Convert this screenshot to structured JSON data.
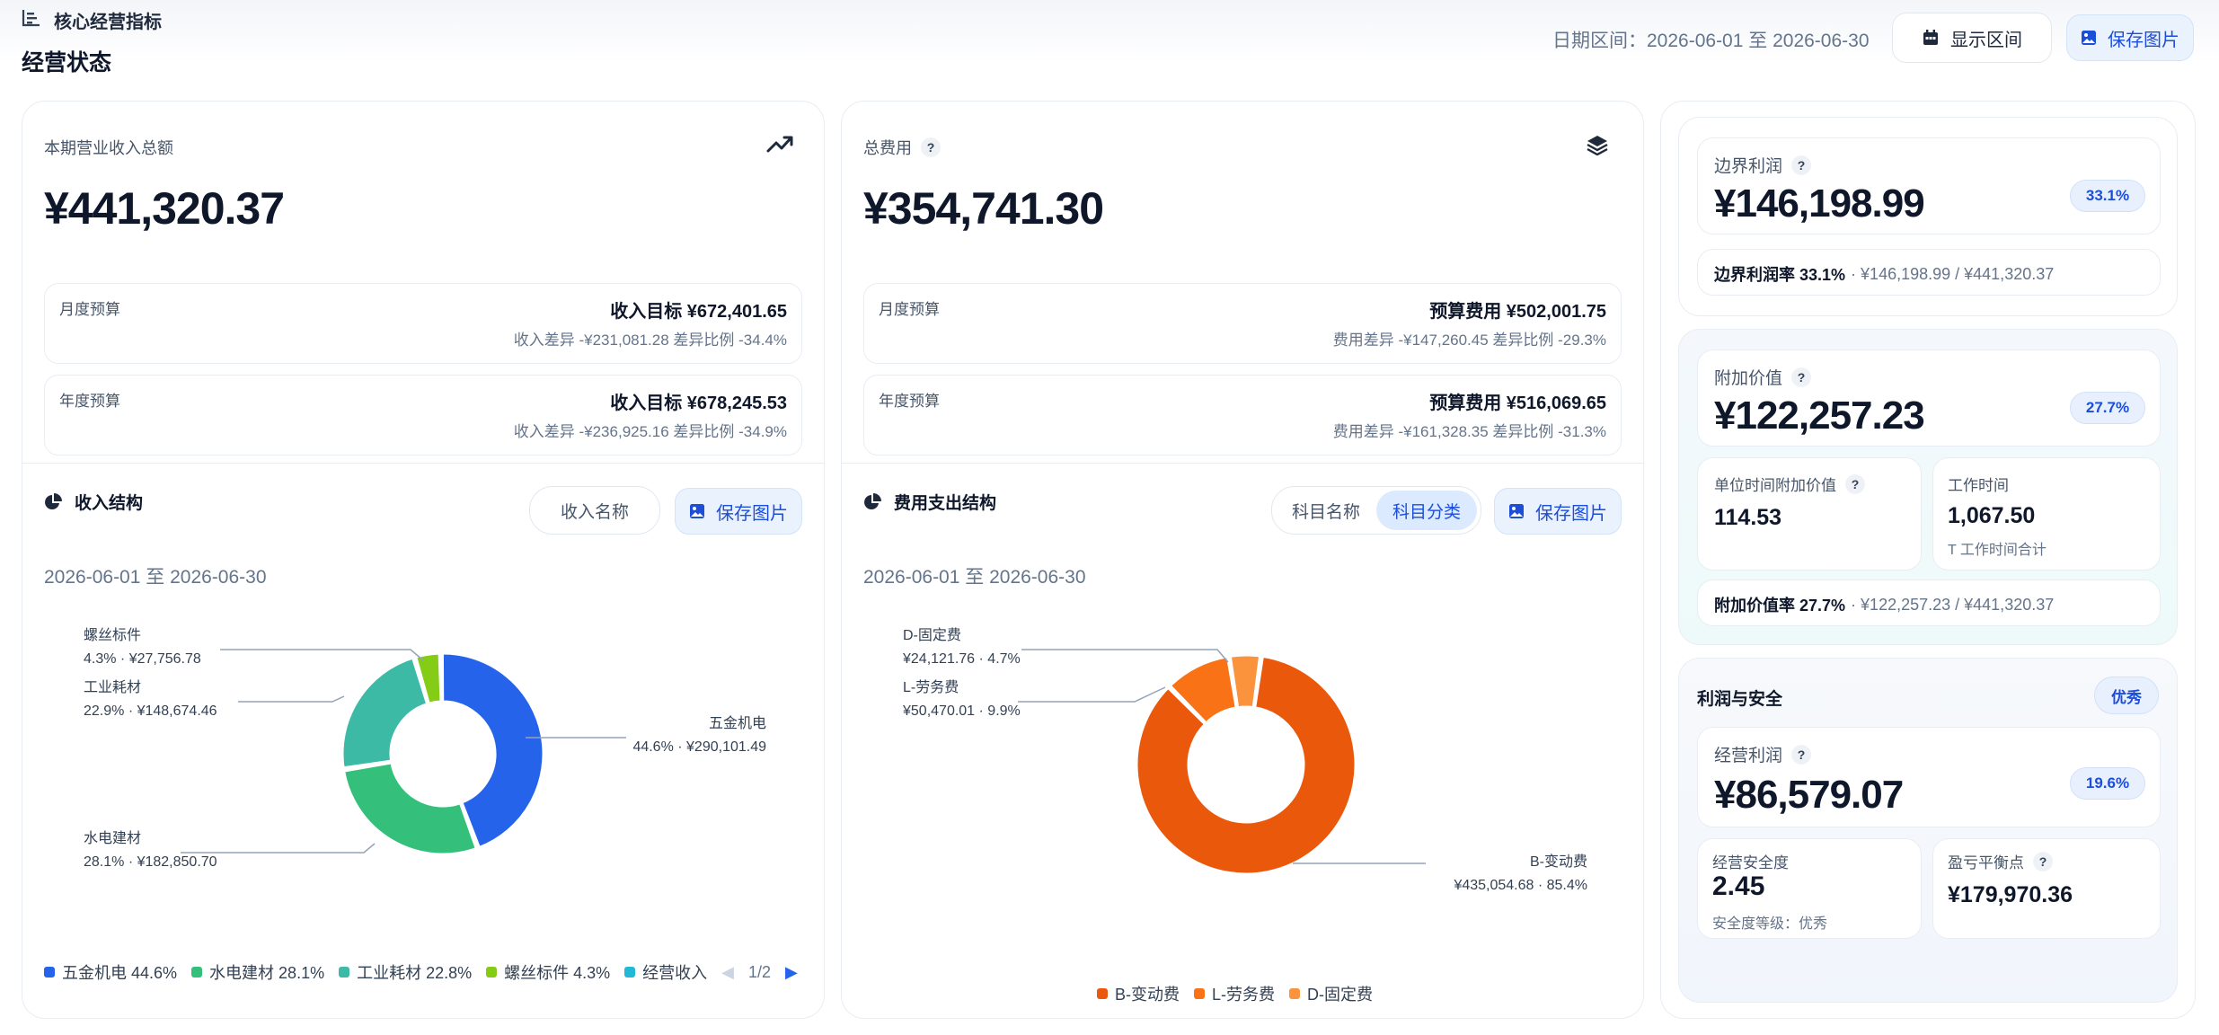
{
  "header": {
    "section_label": "核心经营指标",
    "page_title": "经营状态",
    "date_range_text": "日期区间：2026-06-01 至 2026-06-30",
    "show_range_button": "显示区间",
    "save_image_button": "保存图片"
  },
  "revenue": {
    "label": "本期营业收入总额",
    "value": "¥441,320.37",
    "monthly": {
      "label": "月度预算",
      "target": "收入目标 ¥672,401.65",
      "detail": "收入差异 -¥231,081.28  差异比例 -34.4%"
    },
    "yearly": {
      "label": "年度预算",
      "target": "收入目标 ¥678,245.53",
      "detail": "收入差异 -¥236,925.16  差异比例 -34.9%"
    },
    "structure": {
      "title": "收入结构",
      "toggle_label": "收入名称",
      "save_label": "保存图片",
      "date": "2026-06-01 至 2026-06-30",
      "callouts": [
        {
          "name": "螺丝标件",
          "detail": "4.3% · ¥27,756.78"
        },
        {
          "name": "工业耗材",
          "detail": "22.9% · ¥148,674.46"
        },
        {
          "name": "水电建材",
          "detail": "28.1% · ¥182,850.70"
        },
        {
          "name": "五金机电",
          "detail": "44.6% · ¥290,101.49"
        }
      ],
      "legend": [
        "五金机电 44.6%",
        "水电建材 28.1%",
        "工业耗材 22.8%",
        "螺丝标件 4.3%",
        "经营收入"
      ],
      "legend_page": "1/2"
    }
  },
  "expense": {
    "label": "总费用",
    "value": "¥354,741.30",
    "monthly": {
      "label": "月度预算",
      "target": "预算费用 ¥502,001.75",
      "detail": "费用差异 -¥147,260.45  差异比例 -29.3%"
    },
    "yearly": {
      "label": "年度预算",
      "target": "预算费用 ¥516,069.65",
      "detail": "费用差异 -¥161,328.35  差异比例 -31.3%"
    },
    "structure": {
      "title": "费用支出结构",
      "toggle_a": "科目名称",
      "toggle_b": "科目分类",
      "save_label": "保存图片",
      "date": "2026-06-01 至 2026-06-30",
      "callouts": [
        {
          "name": "D-固定费",
          "detail": "¥24,121.76 · 4.7%"
        },
        {
          "name": "L-劳务费",
          "detail": "¥50,470.01 · 9.9%"
        },
        {
          "name": "B-变动费",
          "detail": "¥435,054.68 · 85.4%"
        }
      ],
      "legend": [
        "B-变动费",
        "L-劳务费",
        "D-固定费"
      ]
    }
  },
  "marginal": {
    "label": "边界利润",
    "value": "¥146,198.99",
    "pill": "33.1%",
    "rate_label": "边界利润率 33.1%",
    "rate_detail": "· ¥146,198.99 / ¥441,320.37"
  },
  "added_value": {
    "label": "附加价值",
    "value": "¥122,257.23",
    "pill": "27.7%",
    "per_hour_label": "单位时间附加价值",
    "per_hour_value": "114.53",
    "work_time_label": "工作时间",
    "work_time_value": "1,067.50",
    "work_time_note": "T 工作时间合计",
    "rate_label": "附加价值率 27.7%",
    "rate_detail": "· ¥122,257.23 / ¥441,320.37"
  },
  "profit_safety": {
    "title": "利润与安全",
    "badge": "优秀",
    "op_profit_label": "经营利润",
    "op_profit_value": "¥86,579.07",
    "op_profit_pill": "19.6%",
    "safety_label": "经营安全度",
    "safety_value": "2.45",
    "safety_note": "安全度等级：优秀",
    "breakeven_label": "盈亏平衡点",
    "breakeven_value": "¥179,970.36"
  },
  "chart_data": [
    {
      "type": "pie",
      "title": "收入结构",
      "categories": [
        "五金机电",
        "水电建材",
        "工业耗材",
        "螺丝标件"
      ],
      "values": [
        290101.49,
        182850.7,
        148674.46,
        27756.78
      ],
      "percent": [
        44.6,
        28.1,
        22.9,
        4.3
      ],
      "colors": [
        "#2563eb",
        "#34c07a",
        "#3dbaa6",
        "#84cc16"
      ]
    },
    {
      "type": "pie",
      "title": "费用支出结构",
      "categories": [
        "B-变动费",
        "L-劳务费",
        "D-固定费"
      ],
      "values": [
        435054.68,
        50470.01,
        24121.76
      ],
      "percent": [
        85.4,
        9.9,
        4.7
      ],
      "colors": [
        "#ea580c",
        "#f97316",
        "#fb923c"
      ]
    }
  ],
  "legend_colors": {
    "revenue": [
      "#2563eb",
      "#34c07a",
      "#3dbaa6",
      "#84cc16",
      "#22b8d6"
    ],
    "expense": [
      "#ea580c",
      "#f97316",
      "#fb923c"
    ]
  }
}
